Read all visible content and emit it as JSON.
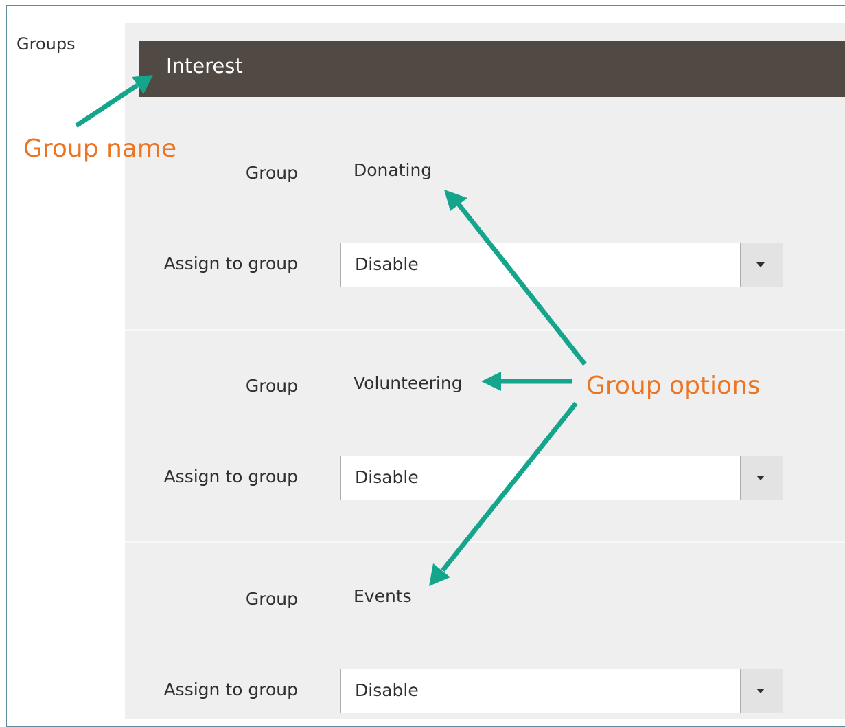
{
  "sidebar": {
    "label": "Groups"
  },
  "group_header": {
    "title": "Interest"
  },
  "rows": [
    {
      "group_label": "Group",
      "group_value": "Donating",
      "assign_label": "Assign to group",
      "select_value": "Disable"
    },
    {
      "group_label": "Group",
      "group_value": "Volunteering",
      "assign_label": "Assign to group",
      "select_value": "Disable"
    },
    {
      "group_label": "Group",
      "group_value": "Events",
      "assign_label": "Assign to group",
      "select_value": "Disable"
    }
  ],
  "annotations": {
    "group_name": "Group name",
    "group_options": "Group options",
    "arrow_color": "#15a58c",
    "text_color": "#eb7522"
  },
  "icons": {
    "select_toggle": "caret-down-icon"
  },
  "colors": {
    "header_bg": "#514943",
    "panel_bg": "#efefef"
  }
}
